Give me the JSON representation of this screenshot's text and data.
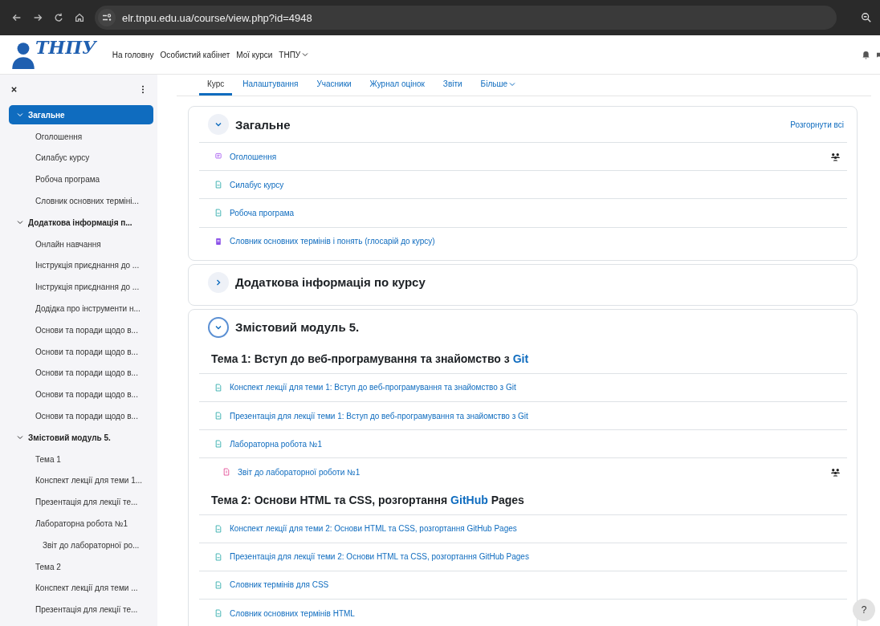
{
  "browser": {
    "url": "elr.tnpu.edu.ua/course/view.php?id=4948"
  },
  "navbar": {
    "logo_text": "ТНПУ",
    "links": [
      {
        "label": "На головну",
        "dropdown": false
      },
      {
        "label": "Особистий кабінет",
        "dropdown": false
      },
      {
        "label": "Мої курси",
        "dropdown": false
      },
      {
        "label": "ТНПУ",
        "dropdown": true
      }
    ]
  },
  "drawer": {
    "items": [
      {
        "label": "Загальне",
        "kind": "section",
        "selected": true,
        "expanded": true,
        "children": [
          {
            "label": "Оголошення",
            "selected": false
          },
          {
            "label": "Силабус курсу",
            "selected": false
          },
          {
            "label": "Робоча програма",
            "selected": false
          },
          {
            "label": "Словник основних терміні...",
            "selected": false
          }
        ]
      },
      {
        "label": "Додаткова інформація п...",
        "kind": "section",
        "selected": false,
        "expanded": true,
        "children": [
          {
            "label": "Онлайн навчання",
            "selected": false
          },
          {
            "label": "Інструкція приєднання до ...",
            "selected": false
          },
          {
            "label": "Інструкція приєднання до ...",
            "selected": false
          },
          {
            "label": "Додідка про інструменти н...",
            "selected": false
          },
          {
            "label": "Основи та поради щодо в...",
            "selected": false
          },
          {
            "label": "Основи та поради щодо в...",
            "selected": false
          },
          {
            "label": "Основи та поради щодо в...",
            "selected": false
          },
          {
            "label": "Основи та поради щодо в...",
            "selected": false
          },
          {
            "label": "Основи та поради щодо в...",
            "selected": false
          }
        ]
      },
      {
        "label": "Змістовий модуль 5.",
        "kind": "section",
        "selected": false,
        "expanded": true,
        "children": [
          {
            "label": "Тема 1",
            "selected": false
          },
          {
            "label": "Конспект лекції для теми 1...",
            "selected": false
          },
          {
            "label": "Презентація для лекції те...",
            "selected": false
          },
          {
            "label": "Лабораторна робота №1",
            "selected": false,
            "children": [
              {
                "label": "Звіт до лабораторної ро...",
                "selected": false
              }
            ]
          },
          {
            "label": "Тема 2",
            "selected": false
          },
          {
            "label": "Конспект лекції для теми ...",
            "selected": false
          },
          {
            "label": "Презентація для лекції те...",
            "selected": false
          }
        ]
      }
    ]
  },
  "tabs": [
    {
      "label": "Курс",
      "selected": true,
      "dropdown": false
    },
    {
      "label": "Налаштування",
      "selected": false,
      "dropdown": false
    },
    {
      "label": "Учасники",
      "selected": false,
      "dropdown": false
    },
    {
      "label": "Журнал оцінок",
      "selected": false,
      "dropdown": false
    },
    {
      "label": "Звіти",
      "selected": false,
      "dropdown": false
    },
    {
      "label": "Більше",
      "selected": false,
      "dropdown": true
    }
  ],
  "sections": [
    {
      "title": "Загальне",
      "expanded": true,
      "focused": false,
      "expand_all": "Розгорнути всі",
      "items": [
        {
          "kind": "forum",
          "label": "Оголошення",
          "group_mode": true
        },
        {
          "kind": "pdf",
          "label": "Силабус курсу",
          "group_mode": false
        },
        {
          "kind": "pdf",
          "label": "Робоча програма",
          "group_mode": false
        },
        {
          "kind": "glossary",
          "label": "Словник основних термінів і понять (глосарій до курсу)",
          "group_mode": false
        }
      ]
    },
    {
      "title": "Додаткова інформація по курсу",
      "expanded": false,
      "focused": false
    },
    {
      "title": "Змістовий модуль 5.",
      "expanded": true,
      "focused": true,
      "items": [
        {
          "kind": "heading",
          "parts": [
            {
              "text": "Тема 1: Вступ до веб-програмування та знайомство з ",
              "link": false
            },
            {
              "text": "Git",
              "link": true
            }
          ]
        },
        {
          "kind": "pdf",
          "label": "Конспект лекції для теми 1: Вступ до веб-програмування та знайомство з Git",
          "group_mode": false
        },
        {
          "kind": "pdf",
          "label": "Презентація для лекції теми 1: Вступ до веб-програмування та знайомство з Git",
          "group_mode": false
        },
        {
          "kind": "pdf",
          "label": "Лабораторна робота №1",
          "group_mode": false,
          "children": [
            {
              "kind": "assign",
              "label": "Звіт до лабораторної роботи №1",
              "group_mode": true
            }
          ]
        },
        {
          "kind": "heading",
          "parts": [
            {
              "text": "Тема 2: Основи HTML та CSS, розгортання ",
              "link": false
            },
            {
              "text": "GitHub",
              "link": true
            },
            {
              "text": " Pages",
              "link": false
            }
          ]
        },
        {
          "kind": "pdf",
          "label": "Конспект лекції для теми 2: Основи HTML та CSS, розгортання GitHub Pages",
          "group_mode": false
        },
        {
          "kind": "pdf",
          "label": "Презентація для лекції теми 2: Основи HTML та CSS, розгортання GitHub Pages",
          "group_mode": false
        },
        {
          "kind": "pdf",
          "label": "Словник термінів для CSS",
          "group_mode": false
        },
        {
          "kind": "pdf",
          "label": "Словник основних термінів HTML",
          "group_mode": false
        }
      ]
    }
  ],
  "help": {
    "label": "?"
  }
}
